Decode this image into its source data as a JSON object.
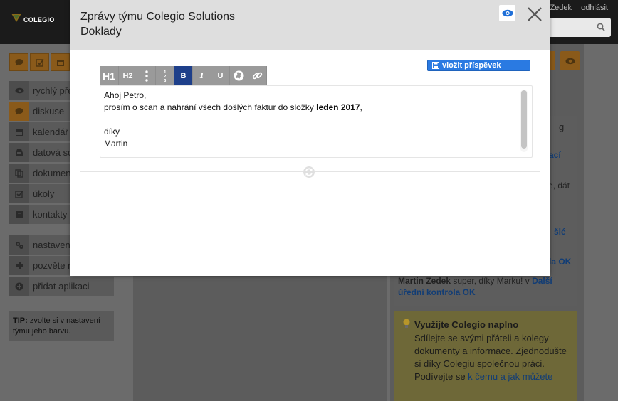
{
  "app": {
    "logo_text": "COLEGIO",
    "top_links": [
      "Zedek",
      "odhlásit"
    ]
  },
  "sidebar": {
    "items": [
      {
        "label": "rychlý pře",
        "icon": "eye-icon",
        "active": false
      },
      {
        "label": "diskuse",
        "icon": "chat-icon",
        "active": true
      },
      {
        "label": "kalendář",
        "icon": "calendar-icon",
        "active": false
      },
      {
        "label": "datová sc",
        "icon": "inbox-icon",
        "active": false
      },
      {
        "label": "dokumen",
        "icon": "documents-icon",
        "active": false
      },
      {
        "label": "úkoly",
        "icon": "checkbox-icon",
        "active": false
      },
      {
        "label": "kontakty",
        "icon": "address-book-icon",
        "active": false
      }
    ],
    "items2": [
      {
        "label": "nastavení",
        "icon": "gears-icon"
      },
      {
        "label": "pozvěte n",
        "icon": "plus-icon"
      },
      {
        "label": "přidat aplikaci",
        "icon": "plus-circle-icon"
      }
    ],
    "tip_bold": "TIP:",
    "tip_text": " zvolte si v nastavení týmu jeho barvu."
  },
  "right_column": {
    "frag_g": "g",
    "frag_aci": "ací",
    "frag_dat": "e, dát",
    "frag_sle": "šlé",
    "frag_ok": "la OK",
    "author": "Martin Zedek",
    "comment": " super, díky Marku! v ",
    "comment_link": "Další úřední kontrola OK",
    "promo_title": "Využijte Colegio naplno",
    "promo_body": "Sdílejte se svými přáteli a kolegy dokumenty a informace. Zjednodušte si díky Colegiu společnou práci.",
    "promo_more_prefix": "Podívejte se ",
    "promo_more_link": "k čemu a jak můžete"
  },
  "modal": {
    "title": "Zprávy týmu Colegio Solutions",
    "subtitle": "Doklady",
    "submit_label": "vložit příspěvek",
    "toolbar": {
      "h1": "H1",
      "h2": "H2",
      "bold": "B",
      "italic": "I",
      "underline": "U"
    },
    "message": {
      "line1": "Ahoj Petro,",
      "line2_prefix": "prosím o scan a nahrání všech došlých faktur do složky ",
      "line2_bold": "leden 2017",
      "line2_suffix": ",",
      "line3": "díky",
      "line4": "Martin"
    }
  },
  "colors": {
    "accent_orange": "#d98a2b",
    "active_blue": "#1e3f8a",
    "submit_blue": "#2a7ae2",
    "link_blue": "#1f5cc4"
  }
}
